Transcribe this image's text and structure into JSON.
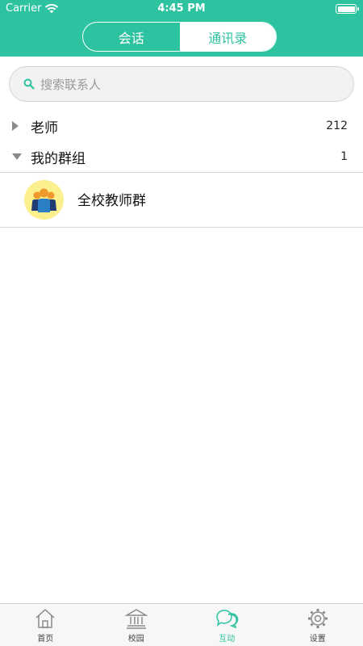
{
  "status_bar": {
    "carrier": "Carrier",
    "time": "4:45 PM"
  },
  "segment": {
    "tab_chat": "会话",
    "tab_contacts": "通讯录",
    "active": "tab_contacts"
  },
  "search": {
    "placeholder": "搜索联系人",
    "icon": "search-icon"
  },
  "groups": [
    {
      "name": "老师",
      "count": "212",
      "expanded": false
    },
    {
      "name": "我的群组",
      "count": "1",
      "expanded": true
    }
  ],
  "members": [
    {
      "name": "全校教师群",
      "icon": "group-avatar"
    }
  ],
  "tabbar": {
    "items": [
      {
        "label": "首页",
        "icon": "home-icon"
      },
      {
        "label": "校园",
        "icon": "campus-icon"
      },
      {
        "label": "互动",
        "icon": "chat-icon"
      },
      {
        "label": "设置",
        "icon": "gear-icon"
      }
    ],
    "active_index": 2
  },
  "colors": {
    "accent": "#2ec3a0",
    "avatar_bg": "#fcf08e"
  }
}
